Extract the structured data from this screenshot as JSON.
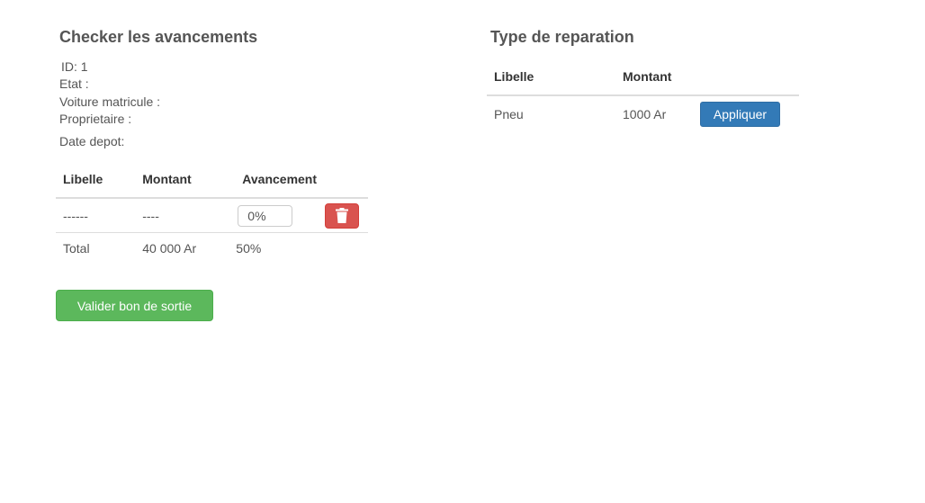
{
  "checker": {
    "title": "Checker les avancements",
    "id_label": "ID: 1",
    "etat_label": "Etat :",
    "voiture_label": "Voiture matricule :",
    "proprietaire_label": "Proprietaire :",
    "date_label": "Date depot:",
    "table": {
      "headers": [
        "Libelle",
        "Montant",
        "Avancement"
      ],
      "row": {
        "libelle": "------",
        "montant": "----",
        "avancement_value": "0%"
      },
      "total": {
        "label": "Total",
        "montant": "40 000 Ar",
        "avancement": "50%"
      }
    },
    "valider_label": "Valider bon de sortie",
    "delete_icon": "trash-icon"
  },
  "reparation": {
    "title": "Type de reparation",
    "headers": [
      "Libelle",
      "Montant"
    ],
    "rows": [
      {
        "libelle": "Pneu",
        "montant": "1000 Ar",
        "action": "Appliquer"
      }
    ]
  },
  "colors": {
    "danger": "#d9534f",
    "success": "#5cb85c",
    "primary": "#337ab7"
  }
}
